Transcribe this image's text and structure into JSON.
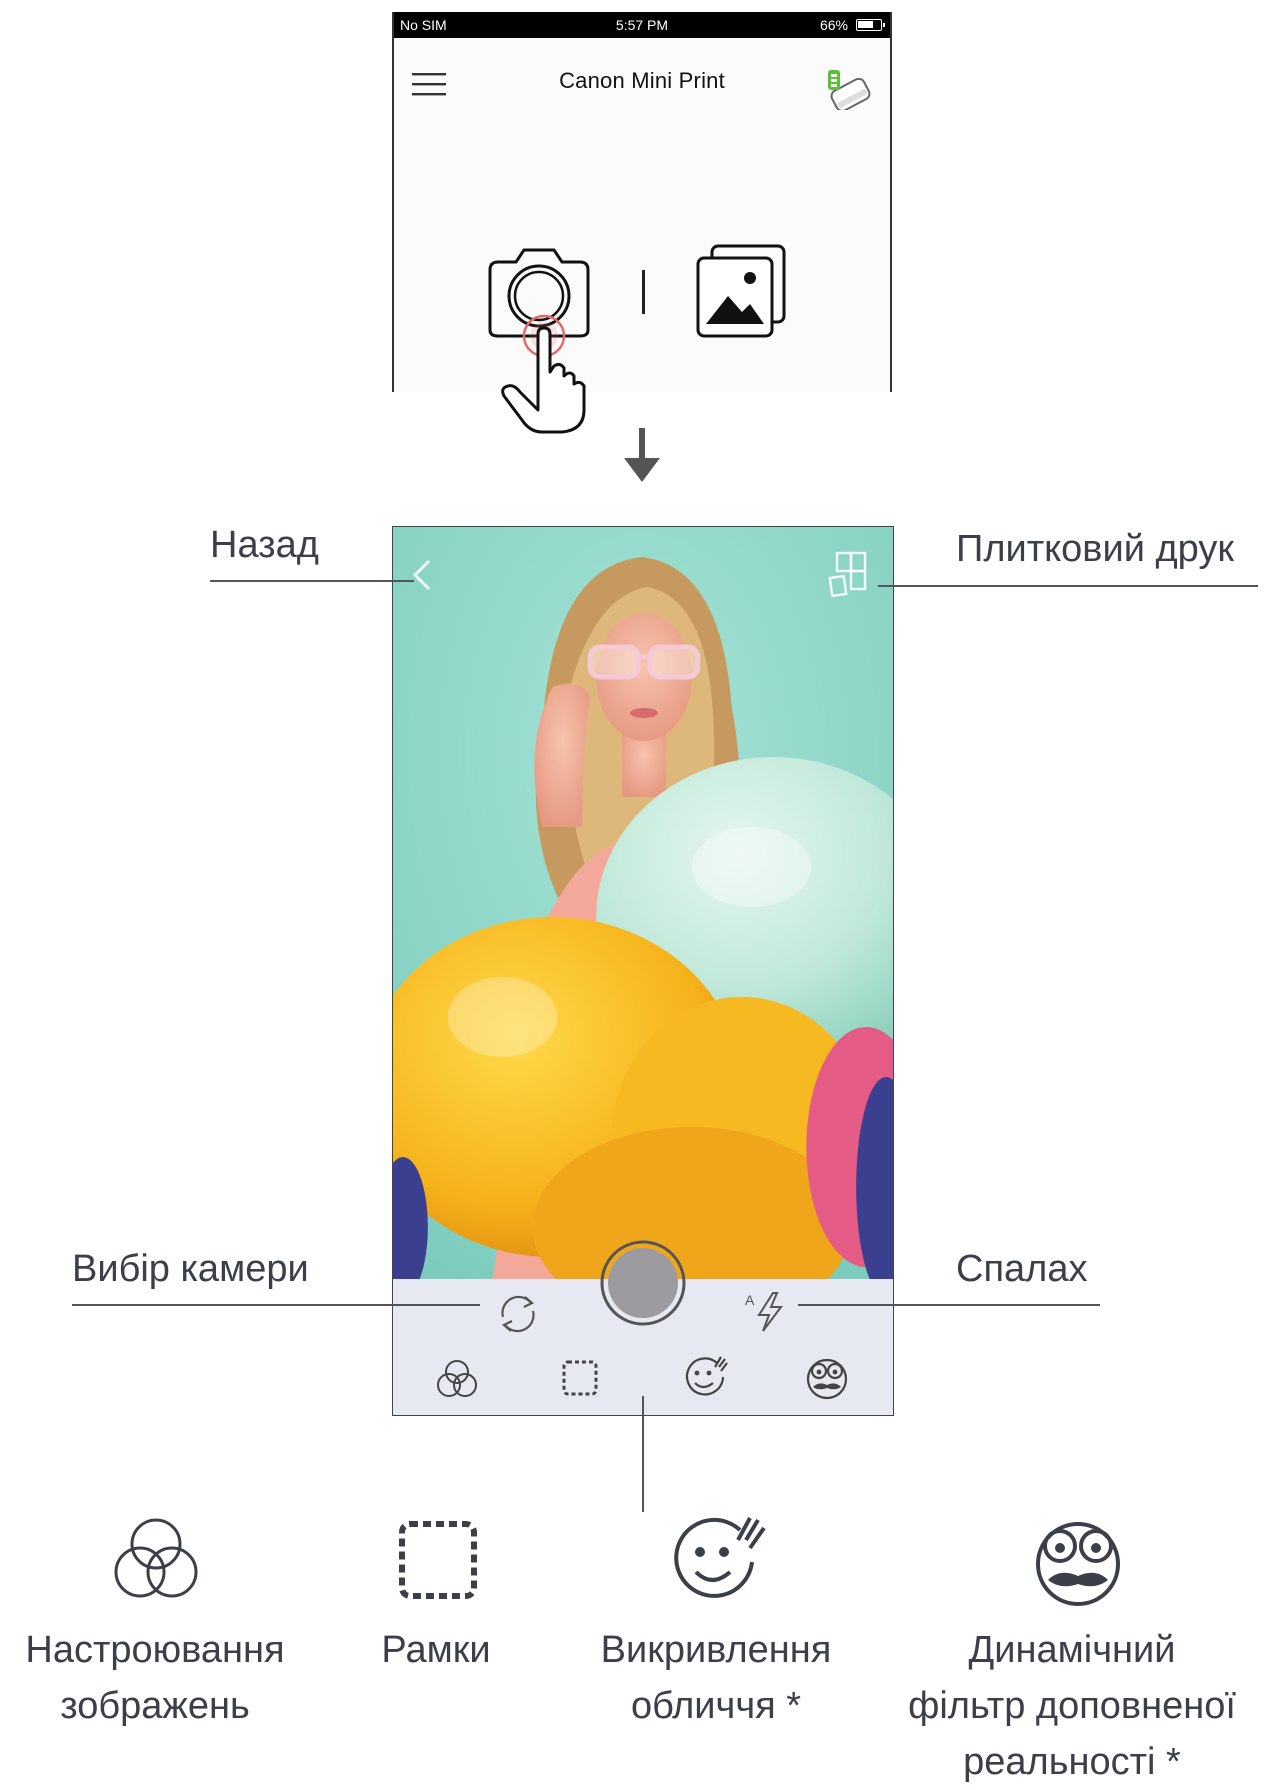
{
  "status_bar": {
    "carrier": "No SIM",
    "time": "5:57 PM",
    "battery": "66%"
  },
  "app": {
    "title": "Canon Mini Print"
  },
  "icons": {
    "menu": "menu-icon",
    "printer": "printer-status-icon",
    "camera": "camera-icon",
    "gallery": "gallery-icon",
    "hand": "tap-hand-icon",
    "arrow": "arrow-down-icon"
  },
  "callouts": {
    "back": "Назад",
    "tile_print": "Плитковий друк",
    "camera_select": "Вибір камери",
    "flash": "Спалах"
  },
  "features": [
    {
      "line1": "Настроювання",
      "line2": "зображень",
      "line3": ""
    },
    {
      "line1": "Рамки",
      "line2": "",
      "line3": ""
    },
    {
      "line1": "Викривлення",
      "line2": "обличчя *",
      "line3": ""
    },
    {
      "line1": "Динамічний",
      "line2": "фільтр доповненої",
      "line3": "реальності *"
    }
  ],
  "colors": {
    "viewfinder_bg": "#8fd7c9",
    "bottom_bar": "#e6e9f1",
    "tap_ring": "#e36a6a",
    "battery_green": "#5bbf3a"
  }
}
